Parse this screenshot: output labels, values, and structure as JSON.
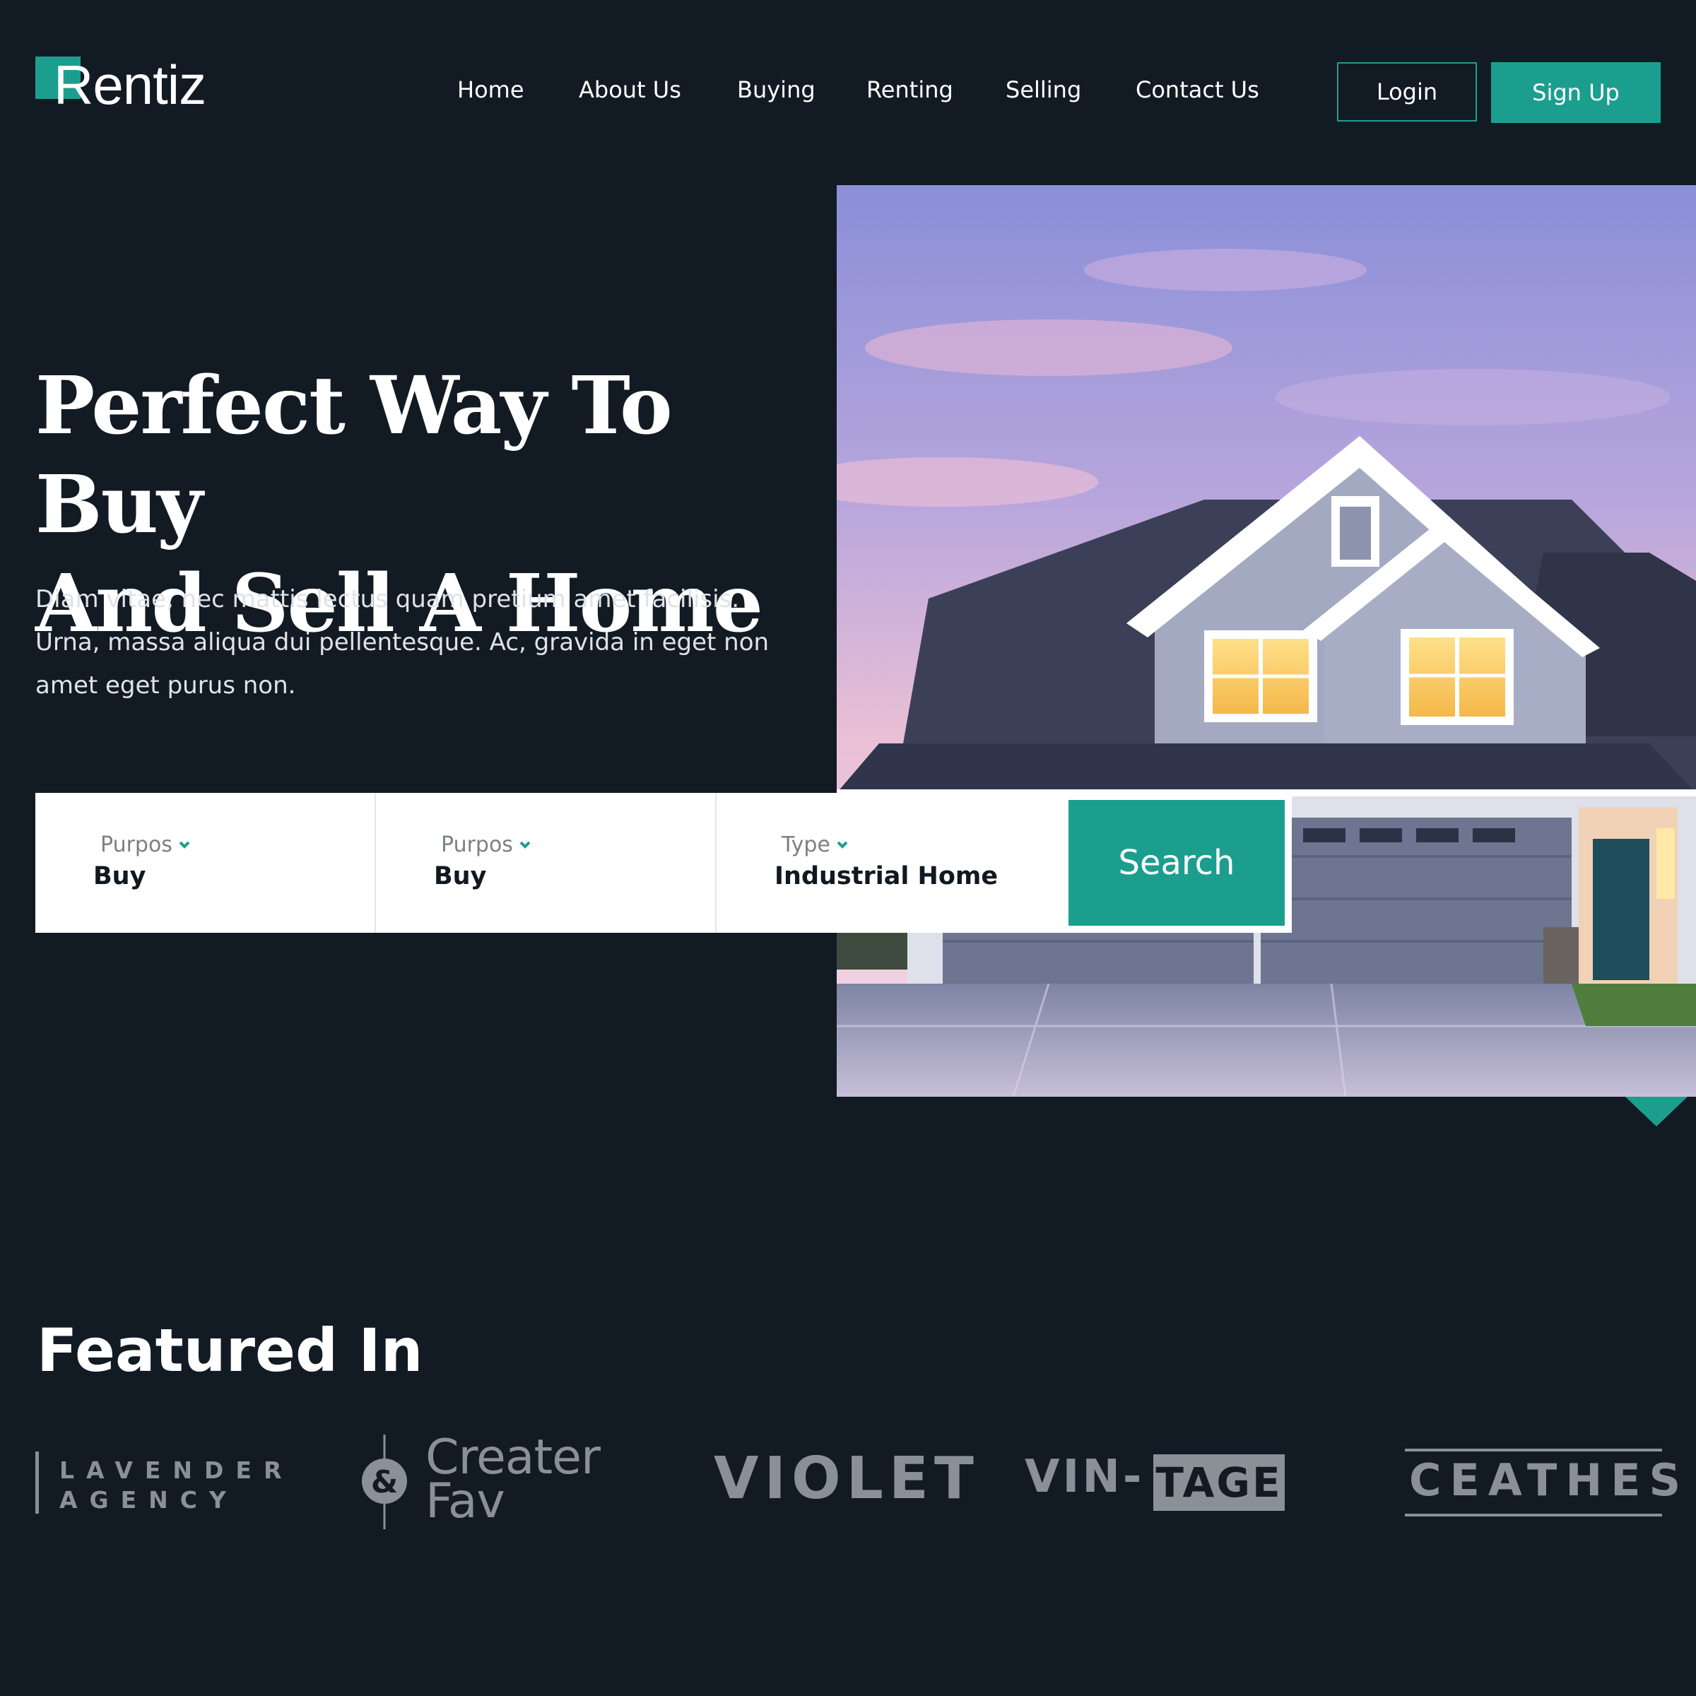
{
  "brand": {
    "name": "Rentiz",
    "accent": "#1c9e8f",
    "background": "#121a24"
  },
  "nav": {
    "items": [
      "Home",
      "About Us",
      "Buying",
      "Renting",
      "Selling",
      "Contact Us"
    ],
    "login_label": "Login",
    "signup_label": "Sign Up"
  },
  "hero": {
    "title_line1": "Perfect Way To Buy",
    "title_line2": "And Sell A Home",
    "description_line1": "Diam vitae, nec mattis lectus quam pretium amet facilisis.",
    "description_line2": "Urna, massa aliqua dui pellentesque. Ac, gravida in eget non",
    "description_line3": "amet eget purus non."
  },
  "search": {
    "fields": [
      {
        "label": "Purpos",
        "value": "Buy",
        "icon": "chevron-down-icon"
      },
      {
        "label": "Purpos",
        "value": "Buy",
        "icon": "chevron-down-icon"
      },
      {
        "label": "Type",
        "value": "Industrial Home",
        "icon": "chevron-down-icon"
      }
    ],
    "button_label": "Search"
  },
  "featured": {
    "title": "Featured In",
    "logos": {
      "lavender": {
        "line1": "LAVENDER",
        "line2": "AGENCY"
      },
      "creater": {
        "line1": "Creater",
        "line2": "Fav",
        "symbol": "&"
      },
      "violet": "VIOLET",
      "vintage": {
        "part1": "VIN-",
        "part2": "TAGE"
      },
      "ceathes": "CEATHES"
    },
    "logo_color": "#8b9097"
  }
}
